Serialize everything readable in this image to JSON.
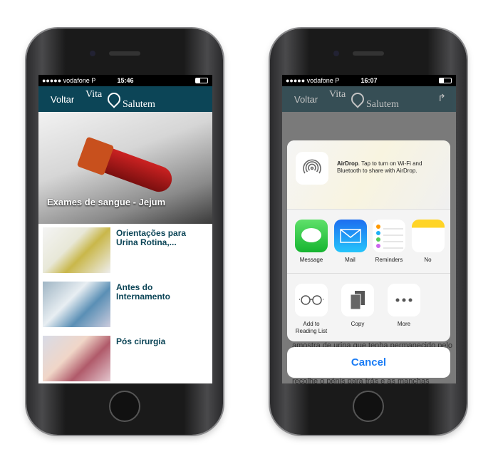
{
  "left": {
    "status": {
      "carrier": "●●●●● vodafone P",
      "time": "15:46"
    },
    "nav": {
      "back": "Voltar",
      "logo_top": "Vita",
      "logo_bottom": "Salutem"
    },
    "hero": {
      "title": "Exames de sangue - Jejum"
    },
    "items": [
      {
        "title": "Orientações para Urina Rotina,..."
      },
      {
        "title": "Antes do Internamento"
      },
      {
        "title": "Pós cirurgia"
      }
    ]
  },
  "right": {
    "status": {
      "carrier": "●●●●● vodafone P",
      "time": "16:07"
    },
    "nav": {
      "back": "Voltar",
      "logo_top": "Vita",
      "logo_bottom": "Salutem"
    },
    "bg_text": [
      "amostra de urina que tenha permanecido pelo",
      "recolhe o pénis para trás e as manchas"
    ],
    "airdrop": {
      "title": "AirDrop",
      "text": ". Tap to turn on Wi-Fi and Bluetooth to share with AirDrop."
    },
    "apps": [
      {
        "label": "Message",
        "color": "#2ecc40"
      },
      {
        "label": "Mail",
        "color": "#1e8af5"
      },
      {
        "label": "Reminders"
      },
      {
        "label": "No"
      }
    ],
    "actions": [
      {
        "label": "Add to Reading List"
      },
      {
        "label": "Copy"
      },
      {
        "label": "More"
      }
    ],
    "cancel": "Cancel"
  }
}
